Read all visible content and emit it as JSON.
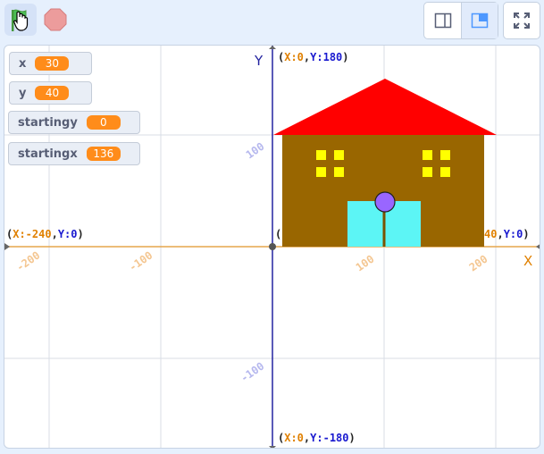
{
  "toolbar": {
    "green_flag_icon": "green-flag-icon",
    "stop_icon": "stop-icon",
    "small_stage_icon": "small-stage-icon",
    "normal_stage_icon": "normal-stage-icon",
    "fullscreen_icon": "fullscreen-icon"
  },
  "monitors": [
    {
      "label": "x",
      "value": "30"
    },
    {
      "label": "y",
      "value": "40"
    },
    {
      "label": "startingy",
      "value": "0"
    },
    {
      "label": "startingx",
      "value": "136"
    }
  ],
  "axes": {
    "y_label": "Y",
    "x_label": "X",
    "top": {
      "x": "X:0",
      "y": "Y:180"
    },
    "bottom": {
      "x": "X:0",
      "y": "Y:-180"
    },
    "left": {
      "x": "X:-240",
      "y": "Y:0"
    },
    "right_partial": {
      "x": "40",
      "y": "Y:0"
    },
    "origin_partial": "(",
    "x_ticks": [
      "-200",
      "-100",
      "100",
      "200"
    ],
    "y_ticks": [
      "100",
      "-100"
    ]
  },
  "colors": {
    "roof": "#ff0000",
    "house": "#996600",
    "window": "#ffff00",
    "door": "#5cf5f5",
    "knob": "#9966ff",
    "x_axis": "#e6a64d",
    "y_axis": "#2323a0",
    "x_text": "#e08000",
    "y_text": "#1a1ad0",
    "monitor_value": "#ff8c1a"
  }
}
